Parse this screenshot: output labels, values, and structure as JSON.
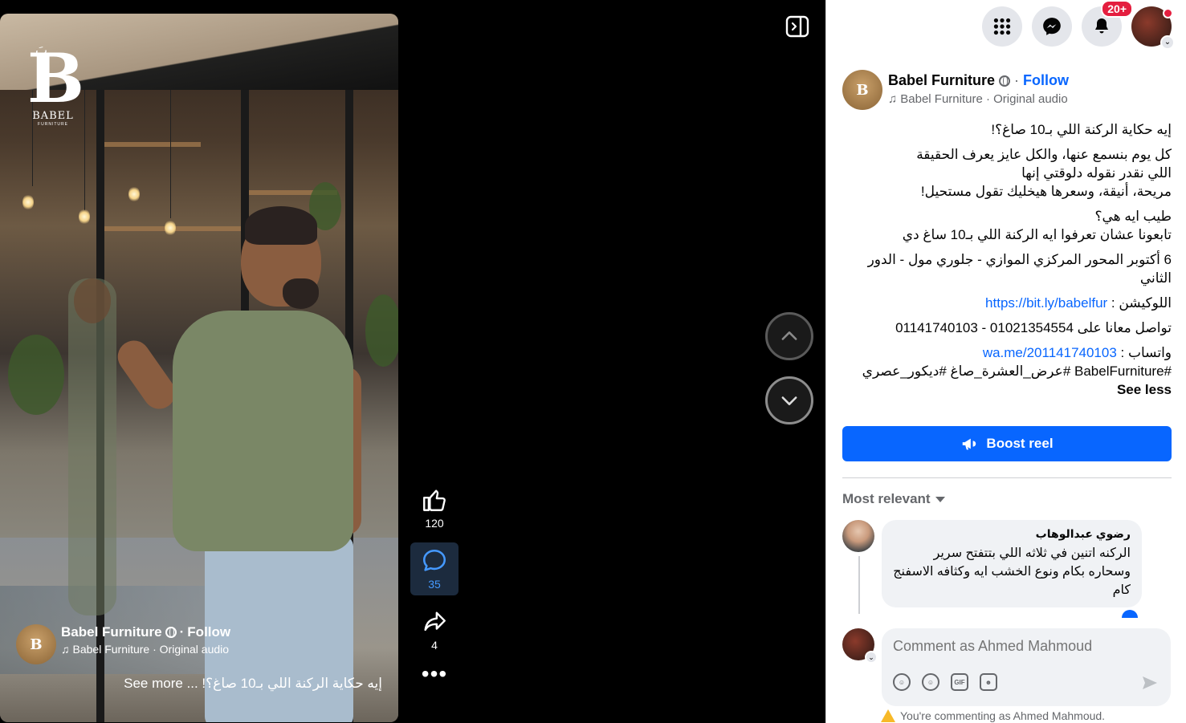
{
  "video": {
    "logo_mark": "B",
    "logo_word": "BABEL",
    "logo_sub": "FURNITURE",
    "logo_ar": "بَ",
    "author": "Babel Furniture",
    "follow": "Follow",
    "sep": "·",
    "audio": "Babel Furniture · Original audio",
    "caption": "إيه حكاية الركنة اللي بـ10 صاغ؟! ... See more"
  },
  "actions": {
    "likes": "120",
    "comments": "35",
    "shares": "4",
    "more": "•••"
  },
  "topbar": {
    "notifications_badge": "20+"
  },
  "post": {
    "author": "Babel Furniture",
    "sep": "·",
    "follow": "Follow",
    "audio": "Babel Furniture · Original audio",
    "avatar_letter": "B",
    "lines": {
      "l1": "إيه حكاية الركنة اللي بـ10 صاغ؟!",
      "l2": "كل يوم بنسمع عنها، والكل عايز يعرف الحقيقة",
      "l3": "اللي نقدر نقوله دلوقتي إنها",
      "l4": "مريحة، أنيقة، وسعرها هيخليك تقول مستحيل!",
      "l5": "طيب ايه هي؟",
      "l6": "تابعونا عشان تعرفوا ايه الركنة اللي بـ10 ساغ دي",
      "l7": "6 أكتوبر المحور المركزي الموازي - جلوري مول - الدور الثاني",
      "l8_label": "اللوكيشن : ",
      "l8_link": "https://bit.ly/babelfur",
      "l9": "تواصل معانا على 01021354554 - 01141740103",
      "l10_label": "واتساب : ",
      "l10_link": "wa.me/201141740103",
      "hashtags": "#BabelFurniture #عرض_العشرة_صاغ #ديكور_عصري",
      "see_less": "See less"
    },
    "boost": "Boost reel",
    "sort": "Most relevant"
  },
  "comment": {
    "name": "رضوي عبدالوهاب",
    "text": "الركنه اتنين في ثلاثه اللي بتتفتح سرير وسحاره بكام ونوع الخشب ايه وكثافه الاسفنج كام"
  },
  "composer": {
    "placeholder": "Comment as Ahmed Mahmoud",
    "gif": "GIF",
    "warning": "You're commenting as Ahmed Mahmoud."
  },
  "colors": {
    "accent": "#0866ff",
    "badge": "#e41e3f",
    "active_action_bg": "#1c2b3e"
  }
}
